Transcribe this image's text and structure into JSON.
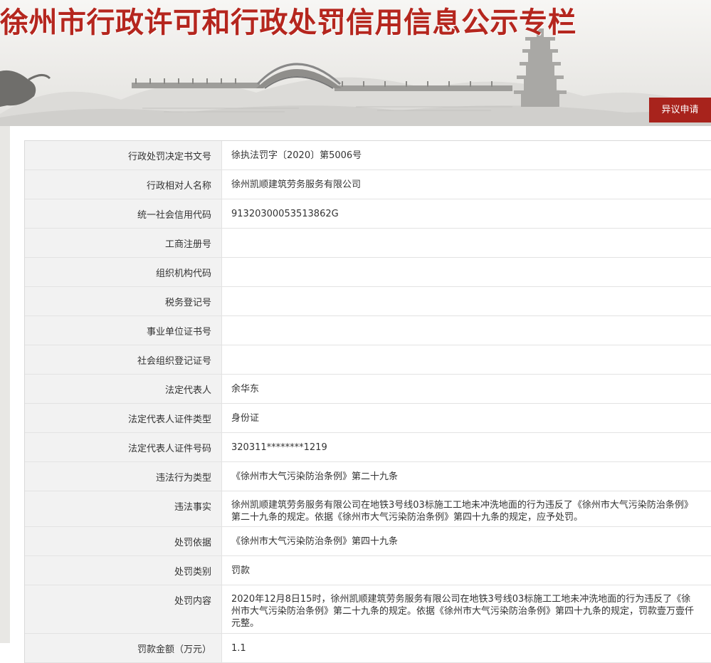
{
  "header": {
    "title": "徐州市行政许可和行政处罚信用信息公示专栏",
    "objection_button": "异议申请"
  },
  "colors": {
    "brand_red": "#b5261e",
    "button_red": "#a8231c",
    "label_bg": "#f2f2f2"
  },
  "record": {
    "rows": [
      {
        "label": "行政处罚决定书文号",
        "value": "徐执法罚字〔2020〕第5006号"
      },
      {
        "label": "行政相对人名称",
        "value": "徐州凯顺建筑劳务服务有限公司"
      },
      {
        "label": "统一社会信用代码",
        "value": "91320300053513862G"
      },
      {
        "label": "工商注册号",
        "value": ""
      },
      {
        "label": "组织机构代码",
        "value": ""
      },
      {
        "label": "税务登记号",
        "value": ""
      },
      {
        "label": "事业单位证书号",
        "value": ""
      },
      {
        "label": "社会组织登记证号",
        "value": ""
      },
      {
        "label": "法定代表人",
        "value": "余华东"
      },
      {
        "label": "法定代表人证件类型",
        "value": "身份证"
      },
      {
        "label": "法定代表人证件号码",
        "value": "320311********1219"
      },
      {
        "label": "违法行为类型",
        "value": "《徐州市大气污染防治条例》第二十九条"
      },
      {
        "label": "违法事实",
        "value": "徐州凯顺建筑劳务服务有限公司在地铁3号线03标施工工地未冲洗地面的行为违反了《徐州市大气污染防治条例》第二十九条的规定。依据《徐州市大气污染防治条例》第四十九条的规定，应予处罚。"
      },
      {
        "label": "处罚依据",
        "value": "《徐州市大气污染防治条例》第四十九条"
      },
      {
        "label": "处罚类别",
        "value": "罚款"
      },
      {
        "label": "处罚内容",
        "value": "2020年12月8日15时，徐州凯顺建筑劳务服务有限公司在地铁3号线03标施工工地未冲洗地面的行为违反了《徐州市大气污染防治条例》第二十九条的规定。依据《徐州市大气污染防治条例》第四十九条的规定，罚款壹万壹仟元整。"
      },
      {
        "label": "罚款金额（万元）",
        "value": "1.1"
      }
    ]
  }
}
